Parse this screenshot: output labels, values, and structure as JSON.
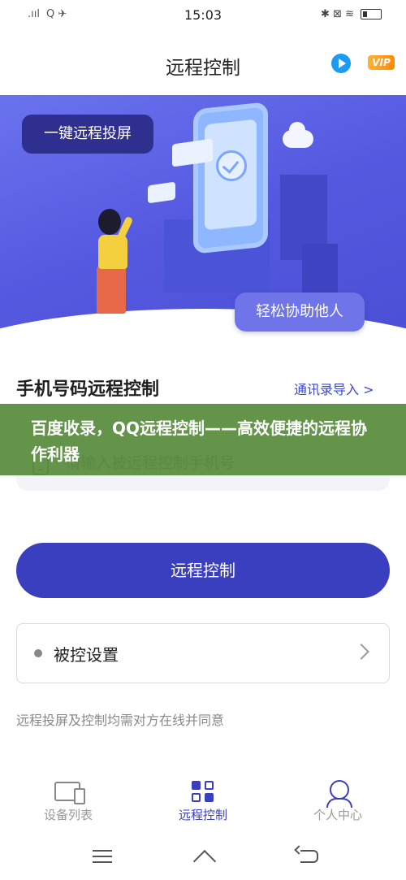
{
  "status_bar": {
    "signal": ".ııl",
    "app_icons": "Q ✈",
    "time": "15:03",
    "right_icons": "✱ ⊠ ≋"
  },
  "header": {
    "title": "远程控制",
    "vip_badge": "VIP"
  },
  "banner": {
    "pill_left": "一键远程投屏",
    "pill_right": "轻松协助他人"
  },
  "section": {
    "title": "手机号码远程控制",
    "contacts_link": "通讯录导入 >"
  },
  "phone_input": {
    "placeholder": "请输入被远程控制手机号"
  },
  "overlay": {
    "text": "百度收录，QQ远程控制——高效便捷的远程协作利器"
  },
  "main_button": {
    "label": "远程控制"
  },
  "settings": {
    "label": "被控设置"
  },
  "note": "远程投屏及控制均需对方在线并同意",
  "bottom_nav": {
    "items": [
      {
        "label": "设备列表",
        "icon": "devices-icon",
        "active": false
      },
      {
        "label": "远程控制",
        "icon": "remote-control-icon",
        "active": true
      },
      {
        "label": "个人中心",
        "icon": "user-icon",
        "active": false
      }
    ]
  },
  "colors": {
    "primary": "#3a3fbf",
    "banner": "#5559e0",
    "overlay": "#578c3c",
    "vip": "#ff8a00"
  }
}
